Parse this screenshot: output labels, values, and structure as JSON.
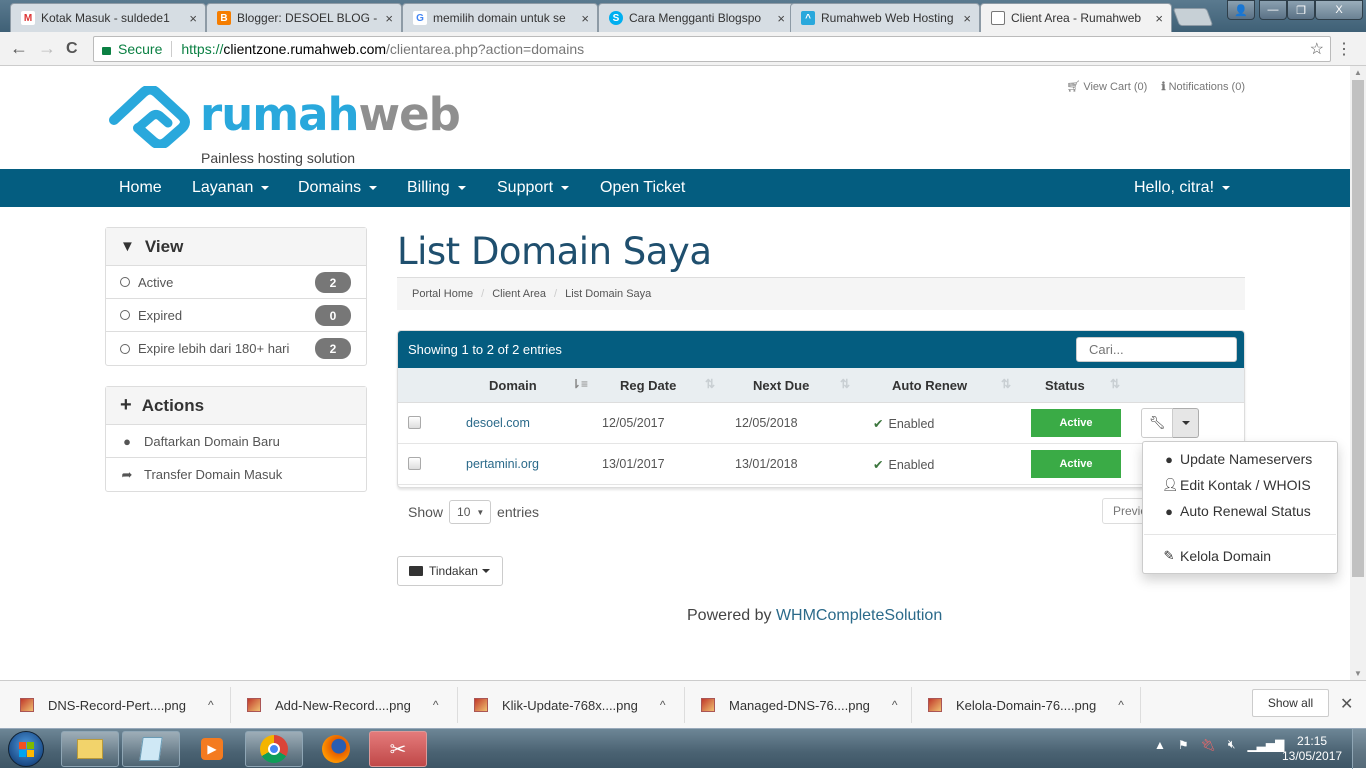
{
  "browser": {
    "tabs": [
      {
        "title": "Kotak Masuk - suldede1",
        "icon": "gmail-icon",
        "active": false
      },
      {
        "title": "Blogger: DESOEL BLOG -",
        "icon": "blogger-icon",
        "active": false
      },
      {
        "title": "memilih domain untuk se",
        "icon": "google-icon",
        "active": false
      },
      {
        "title": "Cara Mengganti Blogspo",
        "icon": "skype-s-icon",
        "active": false
      },
      {
        "title": "Rumahweb Web Hosting",
        "icon": "rumahweb-icon",
        "active": false
      },
      {
        "title": "Client Area - Rumahweb",
        "icon": "page-icon",
        "active": true
      }
    ],
    "tab_close": "×",
    "secure_label": "Secure",
    "url_scheme": "https://",
    "url_host": "clientzone.rumahweb.com",
    "url_rest": "/clientarea.php?action=domains",
    "back": "←",
    "forward": "→",
    "reload": "C",
    "star": "☆",
    "menu": "⋮",
    "win_user": "👤",
    "win_min": "—",
    "win_max": "❐",
    "win_close": "X"
  },
  "site": {
    "logo_part1": "rumah",
    "logo_part2": "web",
    "tagline": "Painless hosting solution",
    "view_cart": "View Cart (0)",
    "notifications": "Notifications (0)",
    "nav": [
      {
        "label": "Home",
        "dropdown": false
      },
      {
        "label": "Layanan",
        "dropdown": true
      },
      {
        "label": "Domains",
        "dropdown": true
      },
      {
        "label": "Billing",
        "dropdown": true
      },
      {
        "label": "Support",
        "dropdown": true
      },
      {
        "label": "Open Ticket",
        "dropdown": false
      }
    ],
    "user_greeting": "Hello, citra!",
    "accent": "#045d80",
    "status_green": "#3aab46"
  },
  "sidebar": {
    "view": {
      "title": "View",
      "items": [
        {
          "label": "Active",
          "count": "2"
        },
        {
          "label": "Expired",
          "count": "0"
        },
        {
          "label": "Expire lebih dari 180+ hari",
          "count": "2"
        }
      ]
    },
    "actions": {
      "title": "Actions",
      "items": [
        {
          "label": "Daftarkan Domain Baru",
          "icon": "globe-icon"
        },
        {
          "label": "Transfer Domain Masuk",
          "icon": "share-arrow-icon"
        }
      ]
    }
  },
  "main": {
    "title": "List Domain Saya",
    "breadcrumb": [
      "Portal Home",
      "Client Area",
      "List Domain Saya"
    ],
    "table": {
      "info": "Showing 1 to 2 of 2 entries",
      "search_placeholder": "Cari...",
      "columns": [
        "Domain",
        "Reg Date",
        "Next Due",
        "Auto Renew",
        "Status"
      ],
      "rows": [
        {
          "domain": "desoel.com",
          "reg_date": "12/05/2017",
          "next_due": "12/05/2018",
          "auto_renew": "Enabled",
          "status": "Active"
        },
        {
          "domain": "pertamini.org",
          "reg_date": "13/01/2017",
          "next_due": "13/01/2018",
          "auto_renew": "Enabled",
          "status": "Active"
        }
      ]
    },
    "dropdown_menu": [
      {
        "label": "Update Nameservers",
        "icon": "globe-icon"
      },
      {
        "label": "Edit Kontak / WHOIS",
        "icon": "user-icon"
      },
      {
        "label": "Auto Renewal Status",
        "icon": "globe-icon"
      },
      {
        "label": "Kelola Domain",
        "icon": "pencil-icon"
      }
    ],
    "show_label": "Show",
    "entries_value": "10",
    "entries_label": "entries",
    "previous_label": "Previous",
    "tindakan_label": "Tindakan",
    "powered_prefix": "Powered by ",
    "powered_link": "WHMCompleteSolution"
  },
  "downloads": {
    "items": [
      "DNS-Record-Pert....png",
      "Add-New-Record....png",
      "Klik-Update-768x....png",
      "Managed-DNS-76....png",
      "Kelola-Domain-76....png"
    ],
    "show_all": "Show all",
    "close": "✕"
  },
  "taskbar": {
    "time": "21:15",
    "date": "13/05/2017",
    "apps": [
      "file-explorer-icon",
      "notepad-icon",
      "media-player-icon",
      "chrome-icon",
      "firefox-icon",
      "snipping-tool-icon"
    ]
  }
}
